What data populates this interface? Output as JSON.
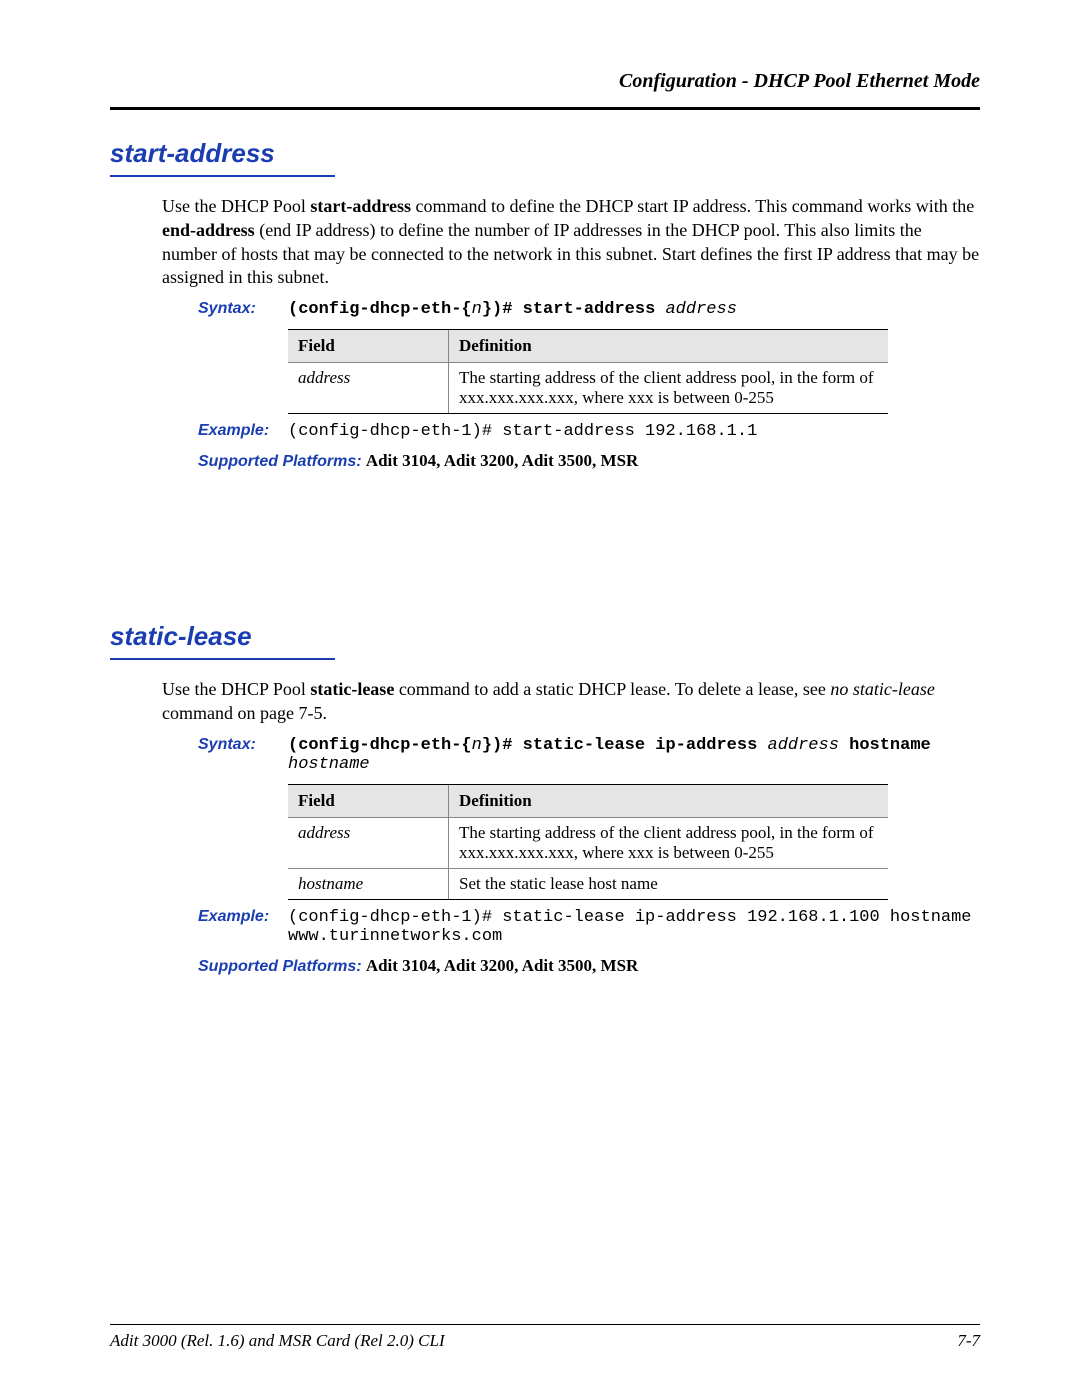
{
  "running_head": "Configuration - DHCP Pool Ethernet Mode",
  "labels": {
    "syntax": "Syntax:",
    "example": "Example:",
    "platforms": "Supported Platforms:",
    "field": "Field",
    "definition": "Definition"
  },
  "section1": {
    "title": "start-address",
    "desc_pre": "Use the DHCP Pool ",
    "desc_bold1": "start-address",
    "desc_mid1": " command to define the DHCP start IP address. This command works with the ",
    "desc_bold2": "end-address",
    "desc_mid2": " (end IP address) to define the number of IP addresses in the DHCP pool. This also limits the number of hosts that may be connected to the network in this subnet. Start defines the first IP address that may be assigned in this subnet.",
    "syntax_pre": "(config-dhcp-eth-{",
    "syntax_n": "n",
    "syntax_mid": "})# start-address ",
    "syntax_arg": "address",
    "table": {
      "rows": [
        {
          "field": "address",
          "def": "The starting address of the client address pool, in the form of xxx.xxx.xxx.xxx, where xxx is between 0-255"
        }
      ]
    },
    "example": "(config-dhcp-eth-1)# start-address 192.168.1.1",
    "platforms": "Adit 3104, Adit 3200, Adit 3500, MSR"
  },
  "section2": {
    "title": "static-lease",
    "desc_pre": "Use the DHCP Pool ",
    "desc_bold1": "static-lease",
    "desc_mid1": " command to add a static DHCP lease. To delete a lease, see ",
    "desc_ital": "no static-lease",
    "desc_post": " command on page 7-5.",
    "syntax_pre": "(config-dhcp-eth-{",
    "syntax_n": "n",
    "syntax_mid": "})# static-lease ip-address ",
    "syntax_arg1": "address",
    "syntax_kw2": " hostname ",
    "syntax_arg2": "hostname",
    "table": {
      "rows": [
        {
          "field": "address",
          "def": "The starting address of the client address pool, in the form of xxx.xxx.xxx.xxx, where xxx is between 0-255"
        },
        {
          "field": "hostname",
          "def": "Set the static lease host name"
        }
      ]
    },
    "example": "(config-dhcp-eth-1)# static-lease ip-address 192.168.1.100 hostname www.turinnetworks.com",
    "platforms": "Adit 3104, Adit 3200, Adit 3500, MSR"
  },
  "footer": {
    "left": "Adit 3000 (Rel. 1.6) and MSR Card (Rel 2.0) CLI",
    "right": "7-7"
  }
}
